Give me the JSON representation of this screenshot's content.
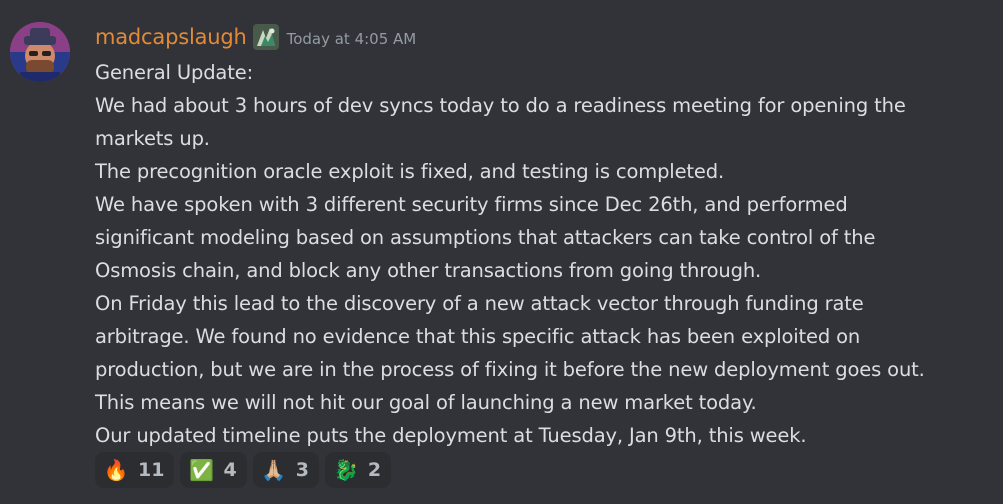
{
  "message": {
    "username": "madcapslaugh",
    "timestamp": "Today at 4:05 AM",
    "lines": [
      "General Update:",
      "We had about 3 hours of dev syncs today to do a readiness meeting for opening the",
      "markets up.",
      "The precognition oracle exploit is fixed, and testing is completed.",
      "We have spoken with 3 different security firms since Dec 26th, and performed",
      "significant modeling based on assumptions that attackers can take control of the",
      "Osmosis chain, and block any other transactions from going through.",
      "On Friday this lead to the discovery of a new attack vector through funding rate",
      "arbitrage. We found no evidence that this specific attack has been exploited on",
      "production, but we are in the process of fixing it before the new deployment goes out.",
      "This means we will not hit our goal of launching a new market today.",
      "Our updated timeline puts the deployment at Tuesday, Jan 9th, this week."
    ],
    "reactions": [
      {
        "emoji": "🔥",
        "icon": "fire-icon",
        "count": "11"
      },
      {
        "emoji": "✅",
        "icon": "check-mark-icon",
        "count": "4"
      },
      {
        "emoji": "🙏🏼",
        "icon": "folded-hands-icon",
        "count": "3"
      },
      {
        "emoji": "🐉",
        "icon": "dragon-icon",
        "count": "2"
      }
    ]
  },
  "colors": {
    "background": "#313338",
    "username": "#e48a37",
    "text": "#dbdee1",
    "timestamp": "#949ba4",
    "reaction_bg": "#2b2d31"
  }
}
